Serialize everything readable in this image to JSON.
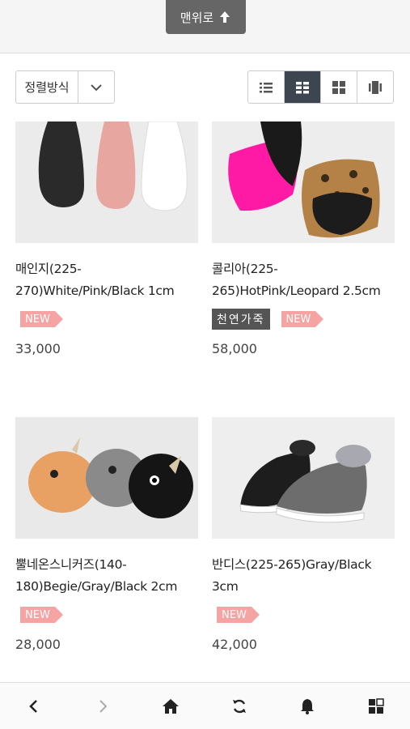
{
  "top": {
    "to_top_label": "맨위로"
  },
  "toolbar": {
    "sort_label": "정렬방식"
  },
  "products": [
    {
      "name": "매인지(225-270)White/Pink/Black 1cm",
      "badges": [
        "NEW"
      ],
      "natural": "",
      "price": "33,000"
    },
    {
      "name": "콜리아(225-265)HotPink/Leopard 2.5cm",
      "badges": [
        "NEW"
      ],
      "natural": "천연가죽",
      "price": "58,000"
    },
    {
      "name": "뿔네온스니커즈(140-180)Begie/Gray/Black 2cm",
      "badges": [
        "NEW"
      ],
      "natural": "",
      "price": "28,000"
    },
    {
      "name": "반디스(225-265)Gray/Black 3cm",
      "badges": [
        "NEW"
      ],
      "natural": "",
      "price": "42,000"
    }
  ],
  "colors": {
    "accent_dark": "#3d4551",
    "new_badge": "#f5a3a3"
  }
}
